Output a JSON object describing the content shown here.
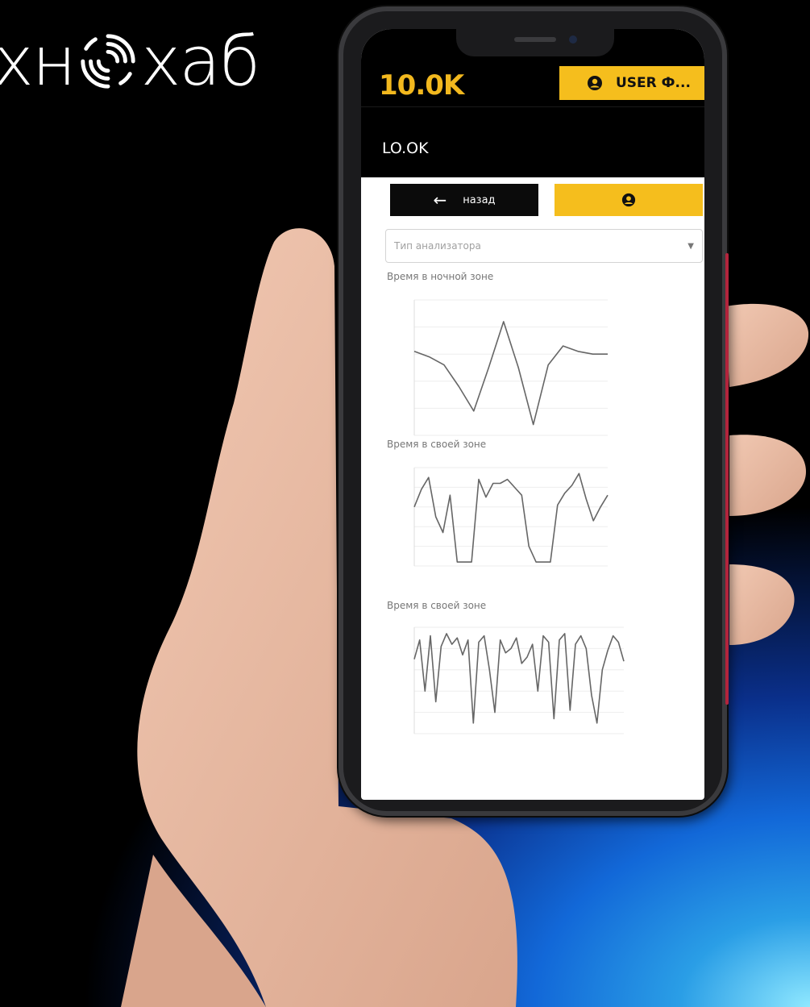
{
  "brand": {
    "text_left": "хн",
    "text_right": "хаб"
  },
  "app": {
    "logo": "10.0K",
    "user_button_label": "USER Ф...",
    "page_title": "LO.OK",
    "back_label": "назад",
    "select_placeholder": "Тип анализатора"
  },
  "colors": {
    "accent": "#f5be1d",
    "bar": "#000000"
  },
  "icons": {
    "user": "user-circle-icon",
    "back": "arrow-left-icon",
    "dropdown": "caret-down-icon"
  },
  "chart_data": [
    {
      "type": "line",
      "title": "Время в ночной зоне",
      "x": [
        0,
        1,
        2,
        3,
        4,
        5,
        6,
        7,
        8,
        9,
        10,
        11,
        12,
        13
      ],
      "series": [
        {
          "values": [
            62,
            58,
            52,
            36,
            18,
            50,
            84,
            50,
            8,
            52,
            66,
            62,
            60,
            60
          ]
        }
      ],
      "ylim": [
        0,
        100
      ]
    },
    {
      "type": "line",
      "title": "Время в своей зоне",
      "x": [
        0,
        1,
        2,
        3,
        4,
        5,
        6,
        7,
        8,
        9,
        10,
        11,
        12,
        13,
        14,
        15,
        16,
        17,
        18,
        19,
        20,
        21,
        22,
        23,
        24,
        25,
        26,
        27
      ],
      "series": [
        {
          "values": [
            60,
            78,
            90,
            50,
            34,
            72,
            4,
            4,
            4,
            88,
            70,
            84,
            84,
            88,
            80,
            72,
            20,
            4,
            4,
            4,
            62,
            74,
            82,
            94,
            68,
            46,
            60,
            72
          ]
        }
      ],
      "ylim": [
        0,
        100
      ]
    },
    {
      "type": "line",
      "title": "Время в своей зоне",
      "x": [
        0,
        1,
        2,
        3,
        4,
        5,
        6,
        7,
        8,
        9,
        10,
        11,
        12,
        13,
        14,
        15,
        16,
        17,
        18,
        19,
        20,
        21,
        22,
        23,
        24,
        25,
        26,
        27,
        28,
        29,
        30,
        31,
        32,
        33,
        34,
        35,
        36,
        37,
        38,
        39
      ],
      "series": [
        {
          "values": [
            70,
            88,
            40,
            92,
            30,
            82,
            94,
            84,
            90,
            74,
            88,
            10,
            86,
            92,
            60,
            20,
            88,
            76,
            80,
            90,
            66,
            72,
            84,
            40,
            92,
            86,
            14,
            88,
            94,
            22,
            84,
            92,
            80,
            36,
            10,
            60,
            78,
            92,
            86,
            68
          ]
        }
      ],
      "ylim": [
        0,
        100
      ]
    }
  ]
}
